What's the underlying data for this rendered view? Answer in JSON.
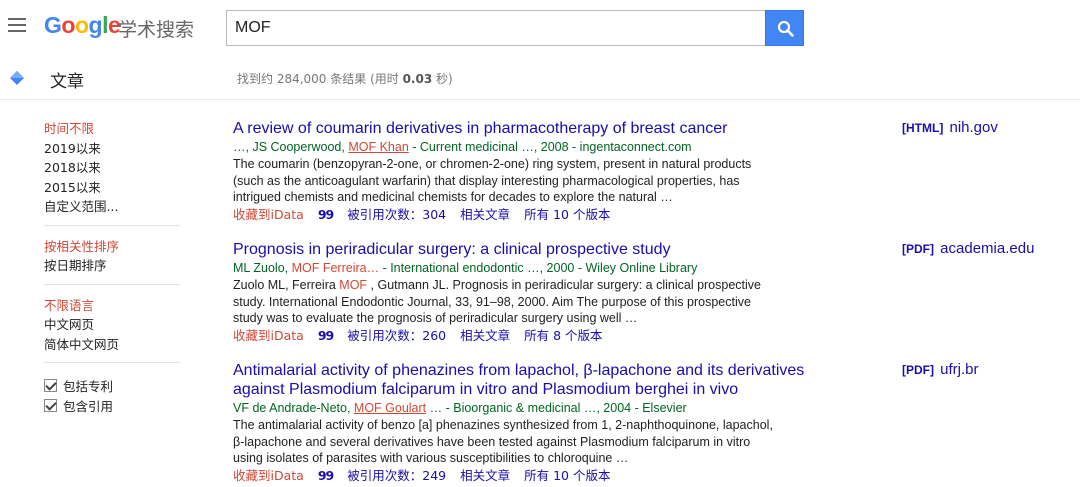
{
  "header": {
    "logo_letters": [
      "G",
      "o",
      "o",
      "g",
      "l",
      "e"
    ],
    "logo_sub": "学术搜索",
    "search_value": "MOF"
  },
  "subbar": {
    "section": "文章",
    "stats_prefix": "找到约 284,000 条结果  (用时 ",
    "stats_time": "0.03",
    "stats_suffix": " 秒)"
  },
  "sidebar": {
    "time": [
      "时间不限",
      "2019以来",
      "2018以来",
      "2015以来",
      "自定义范围..."
    ],
    "sort": [
      "按相关性排序",
      "按日期排序"
    ],
    "lang": [
      "不限语言",
      "中文网页",
      "简体中文网页"
    ],
    "checks": [
      "包括专利",
      "包含引用"
    ]
  },
  "results": [
    {
      "title": "A review of coumarin derivatives in pharmacotherapy of breast cancer",
      "meta_pre": "…, JS Cooperwood, ",
      "meta_hl": "MOF Khan",
      "meta_post": " - Current medicinal …, 2008 - ingentaconnect.com",
      "snippet": "The coumarin (benzopyran-2-one, or chromen-2-one) ring system, present in natural products (such as the anticoagulant warfarin) that display interesting pharmacological properties, has intrigued chemists and medicinal chemists for decades to explore the natural …",
      "save": "收藏到iData",
      "quote": "99",
      "cited": "被引用次数：304",
      "related": "相关文章",
      "versions": "所有 10 个版本",
      "src_tag": "[HTML]",
      "src": "nih.gov"
    },
    {
      "title": "Prognosis in periradicular surgery: a clinical prospective study",
      "meta_pre": "ML Zuolo, ",
      "meta_hl": "MOF Ferreira…",
      "meta_post": " - International endodontic …, 2000 - Wiley Online Library",
      "snippet_pre": "Zuolo ML, Ferreira ",
      "snippet_hl": "MOF",
      "snippet_post": " , Gutmann JL. Prognosis in periradicular surgery: a clinical prospective study. International Endodontic Journal, 33, 91–98, 2000. Aim The purpose of this prospective study was to evaluate the prognosis of periradicular surgery using well …",
      "save": "收藏到iData",
      "quote": "99",
      "cited": "被引用次数：260",
      "related": "相关文章",
      "versions": "所有 8 个版本",
      "src_tag": "[PDF]",
      "src": "academia.edu"
    },
    {
      "title": "Antimalarial activity of phenazines from lapachol, β-lapachone and its derivatives against Plasmodium falciparum in vitro and Plasmodium berghei in vivo",
      "meta_pre": "VF de Andrade-Neto, ",
      "meta_hl": "MOF Goulart",
      "meta_post": " … - Bioorganic & medicinal …, 2004 - Elsevier",
      "snippet": "The antimalarial activity of benzo [a] phenazines synthesized from 1, 2-naphthoquinone, lapachol, β-lapachone and several derivatives have been tested against Plasmodium falciparum in vitro using isolates of parasites with various susceptibilities to chloroquine …",
      "save": "收藏到iData",
      "quote": "99",
      "cited": "被引用次数：249",
      "related": "相关文章",
      "versions": "所有 10 个版本",
      "src_tag": "[PDF]",
      "src": "ufrj.br"
    }
  ]
}
